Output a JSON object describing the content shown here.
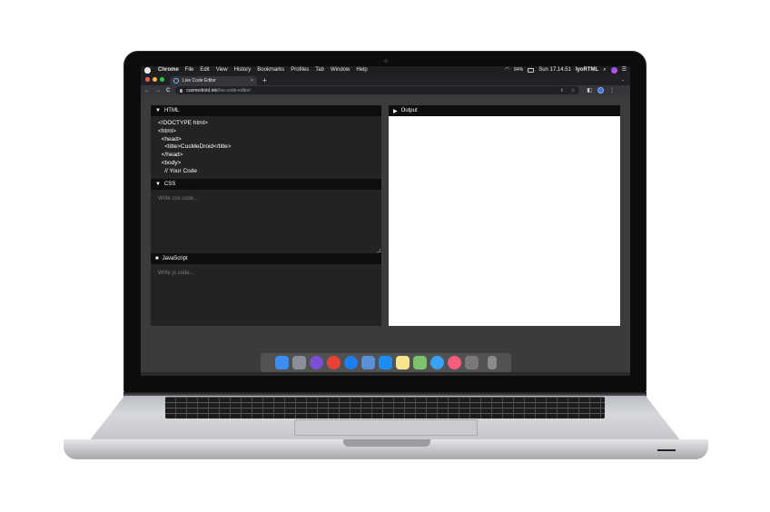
{
  "menubar": {
    "app_name": "Chrome",
    "menus": [
      "File",
      "Edit",
      "View",
      "History",
      "Bookmarks",
      "Profiles",
      "Tab",
      "Window",
      "Help"
    ],
    "battery": "84%",
    "clock": "Sun 17.14.51",
    "user": "IyoRTML",
    "icons": [
      "apple-icon",
      "wifi-icon",
      "battery-icon",
      "search-icon",
      "siri-icon",
      "control-center-icon"
    ]
  },
  "browser": {
    "tab_title": "Live Code Editor",
    "url_host": "cusmedroid.ink",
    "url_path": "/live-code-editor/",
    "new_tab": "+",
    "close": "×",
    "back": "←",
    "forward": "→",
    "reload": "C"
  },
  "editor": {
    "html_panel": {
      "label": "HTML",
      "code": [
        "<!DOCTYPE html>",
        "<html>",
        "  <head>",
        "    <title>CusMeDroid</title>",
        "  </head>",
        "  <body>",
        "    // Your Code"
      ]
    },
    "css_panel": {
      "label": "CSS",
      "placeholder": "Write css code..."
    },
    "js_panel": {
      "label": "JavaScript",
      "placeholder": "Write js code..."
    },
    "output_panel": {
      "label": "Output"
    }
  },
  "dock": {
    "apps": [
      "finder-icon",
      "launchpad-icon",
      "siri-icon",
      "chrome-icon",
      "safari-icon",
      "preview-icon",
      "app-store-icon",
      "notes-icon",
      "photos-icon",
      "messages-icon",
      "music-icon",
      "system-preferences-icon",
      "trash-icon"
    ],
    "colors": [
      "#3d8ef0",
      "#8a8f99",
      "#7b4fd6",
      "#e94235",
      "#1d7ff2",
      "#5b8fd8",
      "#1c8cf2",
      "#f6e58d",
      "#7cc36b",
      "#3aa3f5",
      "#fc5c7d",
      "#7a7a7a",
      "#9a9a9a"
    ]
  },
  "theme": {
    "editor_bg": "#232323",
    "panel_header": "#0e0e0e",
    "page_bg": "#3b3b3b",
    "output_bg": "#ffffff"
  }
}
